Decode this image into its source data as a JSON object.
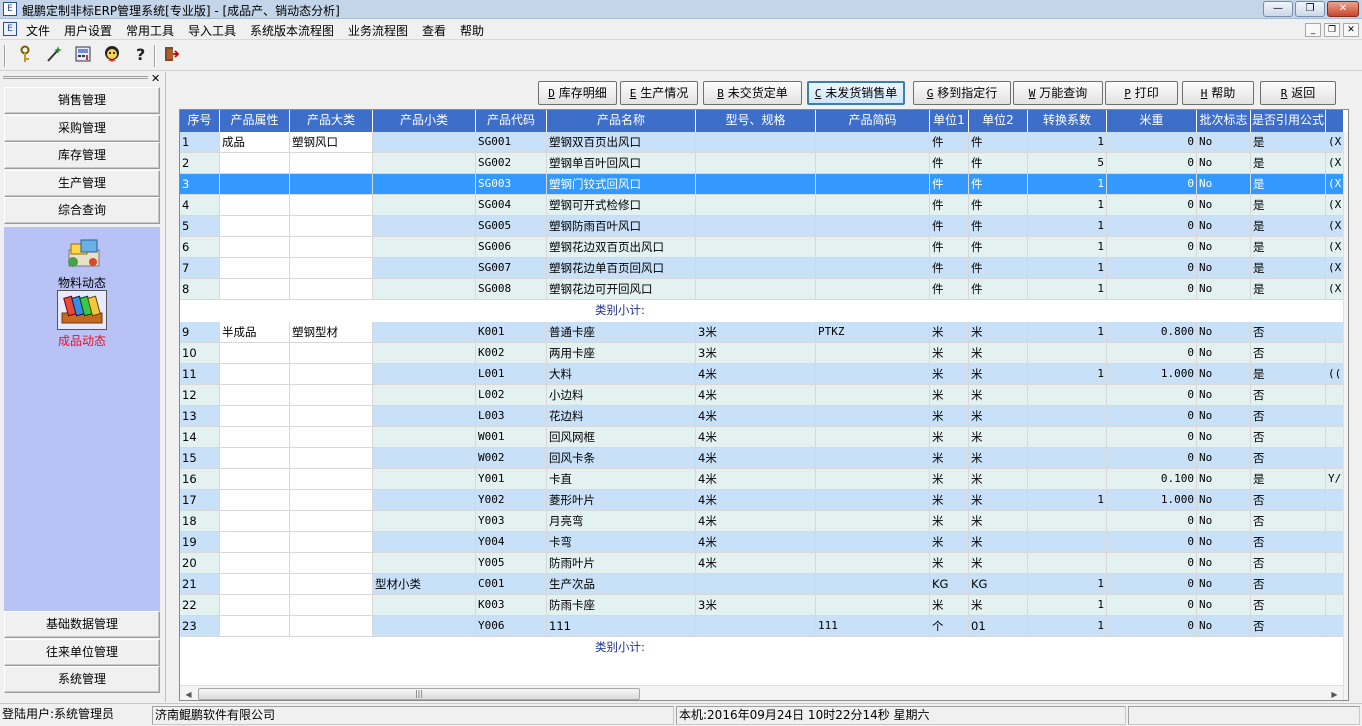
{
  "window": {
    "title": "鲲鹏定制非标ERP管理系统[专业版] - [成品产、销动态分析]",
    "controls": {
      "minimize": "—",
      "maximize": "❐",
      "close": "✕"
    },
    "mdi_controls": {
      "minimize": "_",
      "restore": "❐",
      "close": "✕"
    }
  },
  "menu": [
    "文件",
    "用户设置",
    "常用工具",
    "导入工具",
    "系统版本流程图",
    "业务流程图",
    "查看",
    "帮助"
  ],
  "toolbar_icons": [
    "key-icon",
    "wand-icon",
    "calculator-icon",
    "user-icon",
    "help-icon",
    "exit-icon"
  ],
  "sidebar": {
    "close_label": "✕",
    "top_items": [
      "销售管理",
      "采购管理",
      "库存管理",
      "生产管理",
      "综合查询"
    ],
    "tiles": [
      {
        "label": "物料动态",
        "color": "#000000"
      },
      {
        "label": "成品动态",
        "color": "#e8102a"
      }
    ],
    "bottom_items": [
      "基础数据管理",
      "往来单位管理",
      "系统管理"
    ]
  },
  "actions": [
    {
      "key": "D",
      "label": "库存明细"
    },
    {
      "key": "E",
      "label": "生产情况"
    },
    {
      "key": "B",
      "label": "未交货定单"
    },
    {
      "key": "C",
      "label": "未发货销售单",
      "active": true
    },
    {
      "key": "G",
      "label": "移到指定行"
    },
    {
      "key": "W",
      "label": "万能查询"
    },
    {
      "key": "P",
      "label": "打印"
    },
    {
      "key": "H",
      "label": "帮助"
    },
    {
      "key": "R",
      "label": "返回"
    }
  ],
  "grid": {
    "columns": [
      "序号",
      "产品属性",
      "产品大类",
      "产品小类",
      "产品代码",
      "产品名称",
      "型号、规格",
      "产品简码",
      "单位1",
      "单位2",
      "转换系数",
      "米重",
      "批次标志",
      "是否引用公式",
      ""
    ],
    "rows": [
      {
        "seq": "1",
        "attr": "成品",
        "cat": "塑钢风口",
        "sub": "",
        "code": "SG001",
        "name": "塑钢双百页出风口",
        "spec": "",
        "short": "",
        "u1": "件",
        "u2": "件",
        "factor": "1",
        "weight": "0",
        "batch": "No",
        "formula": "是",
        "extra": "(X"
      },
      {
        "seq": "2",
        "attr": "",
        "cat": "",
        "sub": "",
        "code": "SG002",
        "name": "塑钢单百叶回风口",
        "spec": "",
        "short": "",
        "u1": "件",
        "u2": "件",
        "factor": "5",
        "weight": "0",
        "batch": "No",
        "formula": "是",
        "extra": "(X"
      },
      {
        "seq": "3",
        "attr": "",
        "cat": "",
        "sub": "",
        "code": "SG003",
        "name": "塑钢门铰式回风口",
        "spec": "",
        "short": "",
        "u1": "件",
        "u2": "件",
        "factor": "1",
        "weight": "0",
        "batch": "No",
        "formula": "是",
        "extra": "(X",
        "selected": true
      },
      {
        "seq": "4",
        "attr": "",
        "cat": "",
        "sub": "",
        "code": "SG004",
        "name": "塑钢可开式检修口",
        "spec": "",
        "short": "",
        "u1": "件",
        "u2": "件",
        "factor": "1",
        "weight": "0",
        "batch": "No",
        "formula": "是",
        "extra": "(X"
      },
      {
        "seq": "5",
        "attr": "",
        "cat": "",
        "sub": "",
        "code": "SG005",
        "name": "塑钢防雨百叶风口",
        "spec": "",
        "short": "",
        "u1": "件",
        "u2": "件",
        "factor": "1",
        "weight": "0",
        "batch": "No",
        "formula": "是",
        "extra": "(X"
      },
      {
        "seq": "6",
        "attr": "",
        "cat": "",
        "sub": "",
        "code": "SG006",
        "name": "塑钢花边双百页出风口",
        "spec": "",
        "short": "",
        "u1": "件",
        "u2": "件",
        "factor": "1",
        "weight": "0",
        "batch": "No",
        "formula": "是",
        "extra": "(X"
      },
      {
        "seq": "7",
        "attr": "",
        "cat": "",
        "sub": "",
        "code": "SG007",
        "name": "塑钢花边单百页回风口",
        "spec": "",
        "short": "",
        "u1": "件",
        "u2": "件",
        "factor": "1",
        "weight": "0",
        "batch": "No",
        "formula": "是",
        "extra": "(X"
      },
      {
        "seq": "8",
        "attr": "",
        "cat": "",
        "sub": "",
        "code": "SG008",
        "name": "塑钢花边可开回风口",
        "spec": "",
        "short": "",
        "u1": "件",
        "u2": "件",
        "factor": "1",
        "weight": "0",
        "batch": "No",
        "formula": "是",
        "extra": "(X"
      },
      {
        "subtotal": true,
        "label": "类别小计:"
      },
      {
        "seq": "9",
        "attr": "半成品",
        "cat": "塑钢型材",
        "sub": "",
        "code": "K001",
        "name": "普通卡座",
        "spec": "3米",
        "short": "PTKZ",
        "u1": "米",
        "u2": "米",
        "factor": "1",
        "weight": "0.800",
        "batch": "No",
        "formula": "否",
        "extra": ""
      },
      {
        "seq": "10",
        "attr": "",
        "cat": "",
        "sub": "",
        "code": "K002",
        "name": "两用卡座",
        "spec": "3米",
        "short": "",
        "u1": "米",
        "u2": "米",
        "factor": "",
        "weight": "0",
        "batch": "No",
        "formula": "否",
        "extra": ""
      },
      {
        "seq": "11",
        "attr": "",
        "cat": "",
        "sub": "",
        "code": "L001",
        "name": "大料",
        "spec": "4米",
        "short": "",
        "u1": "米",
        "u2": "米",
        "factor": "1",
        "weight": "1.000",
        "batch": "No",
        "formula": "是",
        "extra": "(("
      },
      {
        "seq": "12",
        "attr": "",
        "cat": "",
        "sub": "",
        "code": "L002",
        "name": "小边料",
        "spec": "4米",
        "short": "",
        "u1": "米",
        "u2": "米",
        "factor": "",
        "weight": "0",
        "batch": "No",
        "formula": "否",
        "extra": ""
      },
      {
        "seq": "13",
        "attr": "",
        "cat": "",
        "sub": "",
        "code": "L003",
        "name": "花边料",
        "spec": "4米",
        "short": "",
        "u1": "米",
        "u2": "米",
        "factor": "",
        "weight": "0",
        "batch": "No",
        "formula": "否",
        "extra": ""
      },
      {
        "seq": "14",
        "attr": "",
        "cat": "",
        "sub": "",
        "code": "W001",
        "name": "回风网框",
        "spec": "4米",
        "short": "",
        "u1": "米",
        "u2": "米",
        "factor": "",
        "weight": "0",
        "batch": "No",
        "formula": "否",
        "extra": ""
      },
      {
        "seq": "15",
        "attr": "",
        "cat": "",
        "sub": "",
        "code": "W002",
        "name": "回风卡条",
        "spec": "4米",
        "short": "",
        "u1": "米",
        "u2": "米",
        "factor": "",
        "weight": "0",
        "batch": "No",
        "formula": "否",
        "extra": ""
      },
      {
        "seq": "16",
        "attr": "",
        "cat": "",
        "sub": "",
        "code": "Y001",
        "name": "卡直",
        "spec": "4米",
        "short": "",
        "u1": "米",
        "u2": "米",
        "factor": "",
        "weight": "0.100",
        "batch": "No",
        "formula": "是",
        "extra": "Y/"
      },
      {
        "seq": "17",
        "attr": "",
        "cat": "",
        "sub": "",
        "code": "Y002",
        "name": "菱形叶片",
        "spec": "4米",
        "short": "",
        "u1": "米",
        "u2": "米",
        "factor": "1",
        "weight": "1.000",
        "batch": "No",
        "formula": "否",
        "extra": ""
      },
      {
        "seq": "18",
        "attr": "",
        "cat": "",
        "sub": "",
        "code": "Y003",
        "name": "月亮弯",
        "spec": "4米",
        "short": "",
        "u1": "米",
        "u2": "米",
        "factor": "",
        "weight": "0",
        "batch": "No",
        "formula": "否",
        "extra": ""
      },
      {
        "seq": "19",
        "attr": "",
        "cat": "",
        "sub": "",
        "code": "Y004",
        "name": "卡弯",
        "spec": "4米",
        "short": "",
        "u1": "米",
        "u2": "米",
        "factor": "",
        "weight": "0",
        "batch": "No",
        "formula": "否",
        "extra": ""
      },
      {
        "seq": "20",
        "attr": "",
        "cat": "",
        "sub": "",
        "code": "Y005",
        "name": "防雨叶片",
        "spec": "4米",
        "short": "",
        "u1": "米",
        "u2": "米",
        "factor": "",
        "weight": "0",
        "batch": "No",
        "formula": "否",
        "extra": ""
      },
      {
        "seq": "21",
        "attr": "",
        "cat": "",
        "sub": "型材小类",
        "code": "C001",
        "name": "生产次品",
        "spec": "",
        "short": "",
        "u1": "KG",
        "u2": "KG",
        "factor": "1",
        "weight": "0",
        "batch": "No",
        "formula": "否",
        "extra": ""
      },
      {
        "seq": "22",
        "attr": "",
        "cat": "",
        "sub": "",
        "code": "K003",
        "name": "防雨卡座",
        "spec": "3米",
        "short": "",
        "u1": "米",
        "u2": "米",
        "factor": "1",
        "weight": "0",
        "batch": "No",
        "formula": "否",
        "extra": ""
      },
      {
        "seq": "23",
        "attr": "",
        "cat": "",
        "sub": "",
        "code": "Y006",
        "name": "111",
        "spec": "",
        "short": "111",
        "u1": "个",
        "u2": "01",
        "factor": "1",
        "weight": "0",
        "batch": "No",
        "formula": "否",
        "extra": ""
      },
      {
        "subtotal": true,
        "label": "类别小计:"
      }
    ]
  },
  "status": {
    "user": "登陆用户:系统管理员",
    "company": "济南鲲鹏软件有限公司",
    "datetime": "本机:2016年09月24日  10时22分14秒  星期六",
    "extra": ""
  },
  "colors": {
    "header": "#3d6ec9",
    "selection": "#3399ff",
    "row_alt": "#c9e1f8",
    "row_plain": "#e4f1f1",
    "side_panel": "#b8c2f4"
  }
}
